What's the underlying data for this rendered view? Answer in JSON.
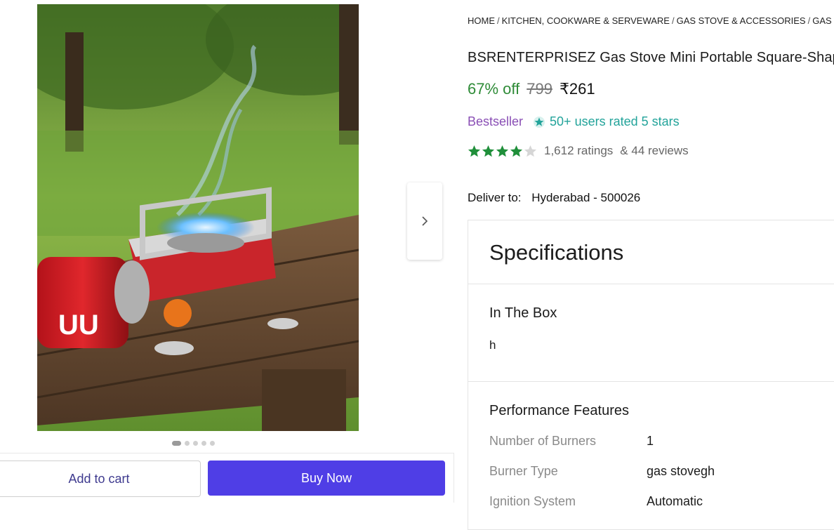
{
  "breadcrumb": [
    "HOME",
    "KITCHEN, COOKWARE & SERVEWARE",
    "GAS STOVE & ACCESSORIES",
    "GAS STO"
  ],
  "product": {
    "title": "BSRENTERPRISEZ Gas Stove Mini Portable Square-Shap",
    "discount": "67% off",
    "mrp": "799",
    "price": "₹261",
    "bestseller": "Bestseller",
    "rated_badge": "50+ users rated 5 stars",
    "rating_value": 4,
    "ratings_text": "1,612 ratings",
    "reviews_text": "& 44 reviews"
  },
  "delivery": {
    "label": "Deliver to:",
    "location": "Hyderabad - 500026"
  },
  "gallery": {
    "total_images": 5,
    "active_index": 0
  },
  "actions": {
    "add_to_cart": "Add to cart",
    "buy_now": "Buy Now"
  },
  "specifications": {
    "title": "Specifications",
    "in_the_box": {
      "heading": "In The Box",
      "value": "h"
    },
    "performance": {
      "heading": "Performance Features",
      "rows": [
        {
          "key": "Number of Burners",
          "value": "1"
        },
        {
          "key": "Burner Type",
          "value": "gas stovegh"
        },
        {
          "key": "Ignition System",
          "value": "Automatic"
        }
      ]
    }
  },
  "colors": {
    "discount": "#2e8b37",
    "bestseller": "#8a4fb5",
    "rated": "#22a39a",
    "buy_button": "#4f3ee6",
    "star": "#1f8f3a"
  },
  "icons": {
    "next": "chevron-right-icon",
    "badge": "star-badge-icon",
    "star": "star-icon"
  }
}
